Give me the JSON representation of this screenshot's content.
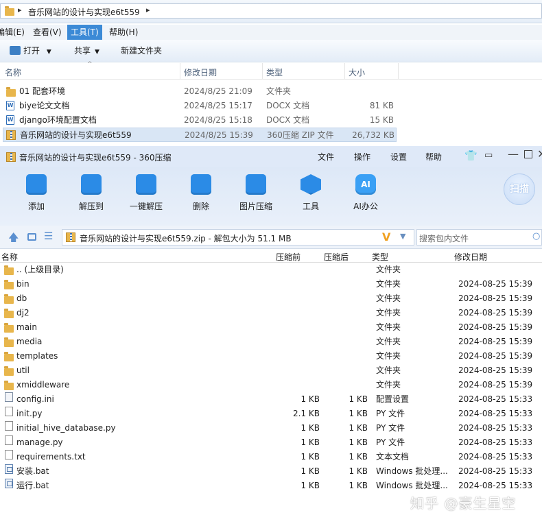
{
  "explorer": {
    "breadcrumb": "音乐网站的设计与实现e6t559",
    "menu": [
      "编辑(E)",
      "查看(V)",
      "工具(T)",
      "帮助(H)"
    ],
    "menu_active": "工具(T)",
    "toolbar": {
      "open": "打开",
      "share": "共享",
      "new_folder": "新建文件夹"
    },
    "columns": {
      "name": "名称",
      "modified": "修改日期",
      "type": "类型",
      "size": "大小"
    },
    "rows": [
      {
        "icon": "folder-icon",
        "name": "01 配套环境",
        "date": "2024/8/25 21:09",
        "type": "文件夹",
        "size": ""
      },
      {
        "icon": "docx-icon",
        "name": "biye论文文档",
        "date": "2024/8/25 15:17",
        "type": "DOCX 文档",
        "size": "81 KB"
      },
      {
        "icon": "docx-icon",
        "name": "django环境配置文档",
        "date": "2024/8/25 15:18",
        "type": "DOCX 文档",
        "size": "15 KB"
      },
      {
        "icon": "zip-icon",
        "name": "音乐网站的设计与实现e6t559",
        "date": "2024/8/25 15:39",
        "type": "360压缩 ZIP 文件",
        "size": "26,732 KB"
      }
    ]
  },
  "zip": {
    "title": "音乐网站的设计与实现e6t559 - 360压缩",
    "menu": [
      "文件",
      "操作",
      "设置",
      "帮助"
    ],
    "tools": [
      {
        "label": "添加",
        "icon": "add-icon",
        "color": "#2b8be6"
      },
      {
        "label": "解压到",
        "icon": "extract-to-icon",
        "color": "#2b8be6"
      },
      {
        "label": "一键解压",
        "icon": "one-click-extract-icon",
        "color": "#2b8be6"
      },
      {
        "label": "删除",
        "icon": "delete-icon",
        "color": "#2b8be6"
      },
      {
        "label": "图片压缩",
        "icon": "image-compress-icon",
        "color": "#2b8be6"
      },
      {
        "label": "工具",
        "icon": "tools-icon",
        "color": "#2b8be6"
      },
      {
        "label": "AI办公",
        "icon": "ai-office-icon",
        "color": "#3aa0f5"
      }
    ],
    "scan": "扫描",
    "path": "音乐网站的设计与实现e6t559.zip - 解包大小为 51.1 MB",
    "search_placeholder": "搜索包内文件",
    "columns": {
      "name": "名称",
      "packed": "压缩前",
      "unpacked": "压缩后",
      "type": "类型",
      "modified": "修改日期"
    },
    "rows": [
      {
        "kind": "folder",
        "name": ".. (上级目录)",
        "before": "",
        "after": "",
        "type": "文件夹",
        "date": ""
      },
      {
        "kind": "folder",
        "name": "bin",
        "before": "",
        "after": "",
        "type": "文件夹",
        "date": "2024-08-25 15:39"
      },
      {
        "kind": "folder",
        "name": "db",
        "before": "",
        "after": "",
        "type": "文件夹",
        "date": "2024-08-25 15:39"
      },
      {
        "kind": "folder",
        "name": "dj2",
        "before": "",
        "after": "",
        "type": "文件夹",
        "date": "2024-08-25 15:39"
      },
      {
        "kind": "folder",
        "name": "main",
        "before": "",
        "after": "",
        "type": "文件夹",
        "date": "2024-08-25 15:39"
      },
      {
        "kind": "folder",
        "name": "media",
        "before": "",
        "after": "",
        "type": "文件夹",
        "date": "2024-08-25 15:39"
      },
      {
        "kind": "folder",
        "name": "templates",
        "before": "",
        "after": "",
        "type": "文件夹",
        "date": "2024-08-25 15:39"
      },
      {
        "kind": "folder",
        "name": "util",
        "before": "",
        "after": "",
        "type": "文件夹",
        "date": "2024-08-25 15:39"
      },
      {
        "kind": "folder",
        "name": "xmiddleware",
        "before": "",
        "after": "",
        "type": "文件夹",
        "date": "2024-08-25 15:39"
      },
      {
        "kind": "cfg",
        "name": "config.ini",
        "before": "1 KB",
        "after": "1 KB",
        "type": "配置设置",
        "date": "2024-08-25 15:33"
      },
      {
        "kind": "file",
        "name": "init.py",
        "before": "2.1 KB",
        "after": "1 KB",
        "type": "PY 文件",
        "date": "2024-08-25 15:33"
      },
      {
        "kind": "file",
        "name": "initial_hive_database.py",
        "before": "1 KB",
        "after": "1 KB",
        "type": "PY 文件",
        "date": "2024-08-25 15:33"
      },
      {
        "kind": "file",
        "name": "manage.py",
        "before": "1 KB",
        "after": "1 KB",
        "type": "PY 文件",
        "date": "2024-08-25 15:33"
      },
      {
        "kind": "file",
        "name": "requirements.txt",
        "before": "1 KB",
        "after": "1 KB",
        "type": "文本文档",
        "date": "2024-08-25 15:33"
      },
      {
        "kind": "bat",
        "name": "安装.bat",
        "before": "1 KB",
        "after": "1 KB",
        "type": "Windows 批处理...",
        "date": "2024-08-25 15:33"
      },
      {
        "kind": "bat",
        "name": "运行.bat",
        "before": "1 KB",
        "after": "1 KB",
        "type": "Windows 批处理...",
        "date": "2024-08-25 15:33"
      }
    ]
  },
  "watermark": "知乎 @豪生星空"
}
